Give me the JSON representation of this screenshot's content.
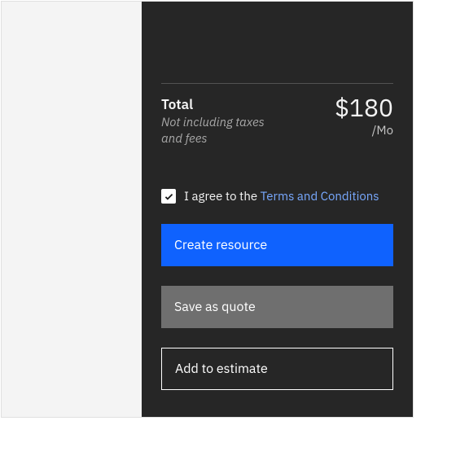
{
  "summary": {
    "total_label": "Total",
    "total_sublabel": "Not including taxes and fees",
    "total_amount": "$180",
    "total_period": "/Mo"
  },
  "agreement": {
    "checked": true,
    "prefix": "I agree to the ",
    "link_text": "Terms and Conditions"
  },
  "actions": {
    "create_label": "Create resource",
    "save_label": "Save as quote",
    "add_label": "Add to estimate"
  }
}
